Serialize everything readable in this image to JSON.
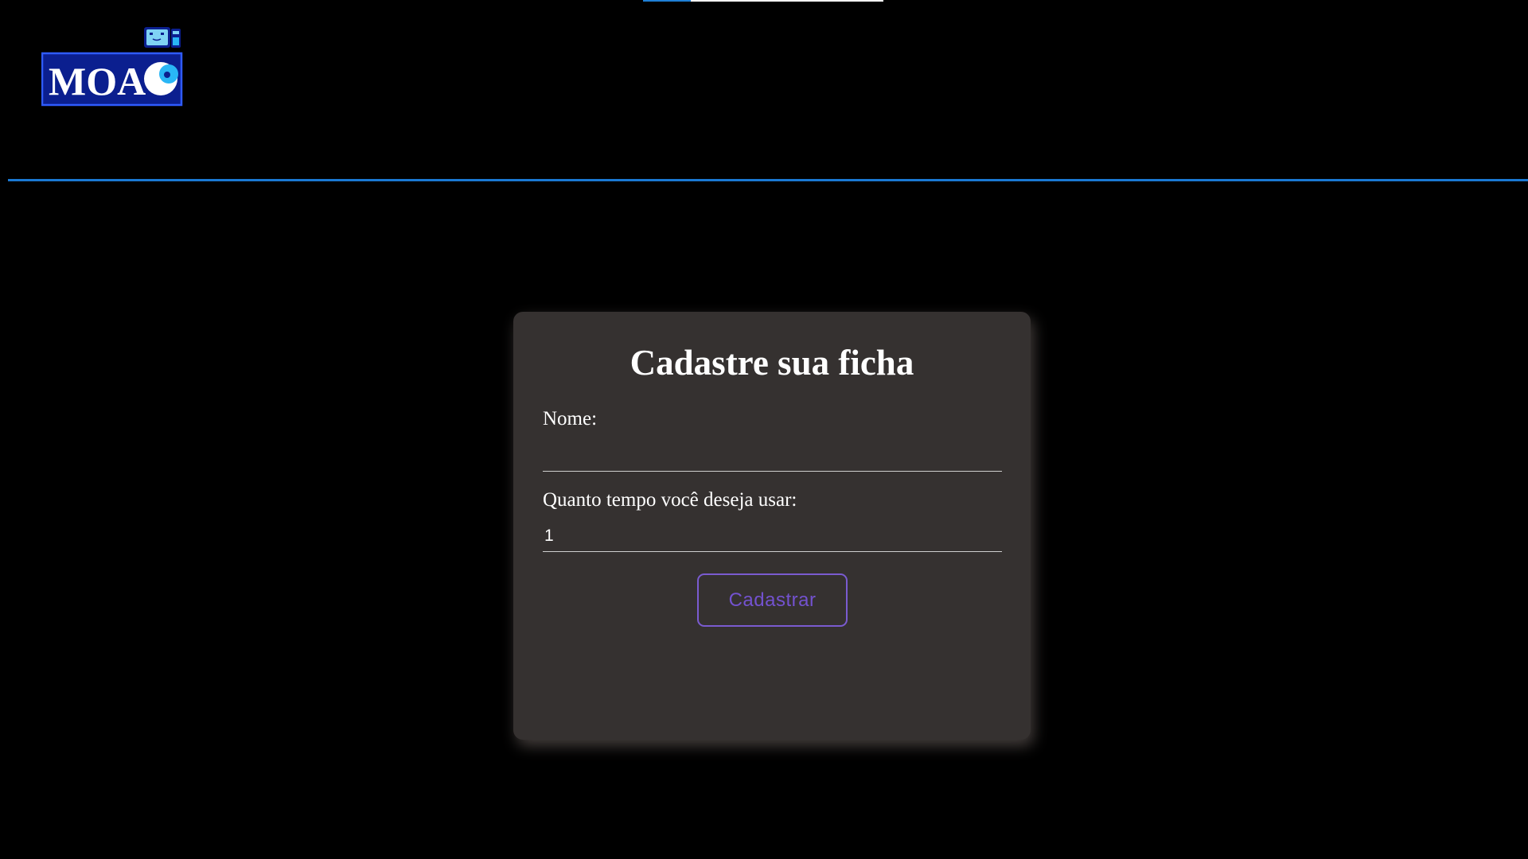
{
  "page": {
    "progress_fraction": 0.2
  },
  "logo": {
    "text": "MOA",
    "brand_color": "#0b1f8f",
    "accent_color": "#29b6f6"
  },
  "form": {
    "title": "Cadastre sua ficha",
    "name_label": "Nome:",
    "name_value": "",
    "time_label": "Quanto tempo você deseja usar:",
    "time_value": "1",
    "submit_label": "Cadastrar"
  },
  "colors": {
    "background": "#000000",
    "card": "#353130",
    "header_rule": "#1a78d2",
    "button_accent": "#7352cf"
  }
}
